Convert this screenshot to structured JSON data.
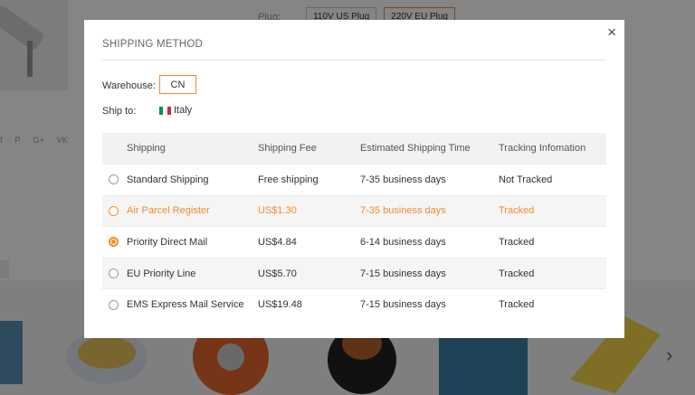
{
  "background": {
    "plug_label": "Plug:",
    "plug_options": [
      "110V US Plug",
      "220V EU Plug"
    ],
    "share_icons": [
      "f",
      "P",
      "G+",
      "VK"
    ]
  },
  "modal": {
    "title": "SHIPPING METHOD",
    "close": "×",
    "warehouse_label": "Warehouse:",
    "warehouse_value": "CN",
    "ship_to_label": "Ship to:",
    "ship_to_value": "Italy",
    "flag_colors": [
      "#009246",
      "#ffffff",
      "#ce2b37"
    ],
    "columns": [
      "Shipping",
      "Shipping Fee",
      "Estimated Shipping Time",
      "Tracking Infomation"
    ],
    "rows": [
      {
        "method": "Standard Shipping",
        "fee": "Free shipping",
        "time": "7-35 business days",
        "tracking": "Not Tracked"
      },
      {
        "method": "Air Parcel Register",
        "fee": "US$1.30",
        "time": "7-35 business days",
        "tracking": "Tracked"
      },
      {
        "method": "Priority Direct Mail",
        "fee": "US$4.84",
        "time": "6-14 business days",
        "tracking": "Tracked"
      },
      {
        "method": "EU Priority Line",
        "fee": "US$5.70",
        "time": "7-15 business days",
        "tracking": "Tracked"
      },
      {
        "method": "EMS Express Mail Service",
        "fee": "US$19.48",
        "time": "7-15 business days",
        "tracking": "Tracked"
      }
    ],
    "selected_row": "Priority Direct Mail",
    "accent_color": "#f08c2e"
  }
}
